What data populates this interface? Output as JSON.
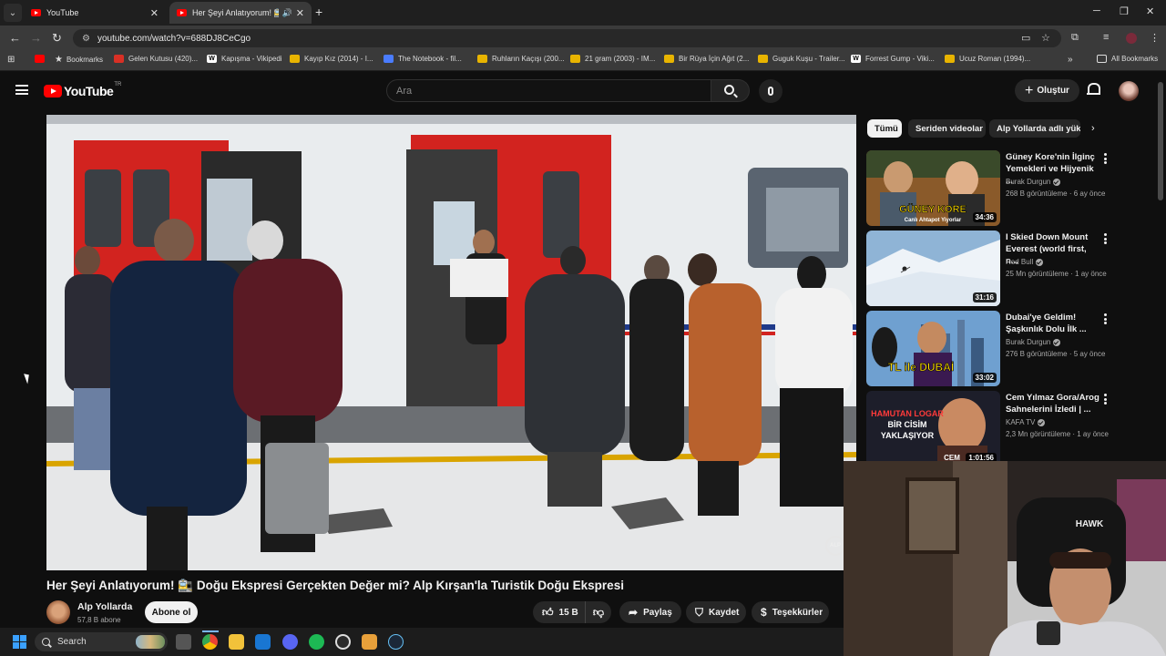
{
  "browser": {
    "tabs": [
      {
        "title": "YouTube",
        "active": false
      },
      {
        "title": "Her Şeyi Anlatıyorum! 🚉 D",
        "active": true
      }
    ],
    "url": "youtube.com/watch?v=688DJ8CeCgo",
    "bookmarks": [
      {
        "label": "Bookmarks",
        "icon": "star-icon"
      },
      {
        "label": "Gelen Kutusu (420)...",
        "icon": "gmail-icon"
      },
      {
        "label": "Kapışma - Vikipedi",
        "icon": "wikipedia-icon"
      },
      {
        "label": "Kayıp Kız (2014) - I...",
        "icon": "imdb-icon"
      },
      {
        "label": "The Notebook - fil...",
        "icon": "site-icon"
      },
      {
        "label": "Ruhların Kaçışı (200...",
        "icon": "imdb-icon"
      },
      {
        "label": "21 gram (2003) - IM...",
        "icon": "imdb-icon"
      },
      {
        "label": "Bir Rüya İçin Ağıt (2...",
        "icon": "imdb-icon"
      },
      {
        "label": "Guguk Kuşu - Trailer...",
        "icon": "imdb-icon"
      },
      {
        "label": "Forrest Gump - Viki...",
        "icon": "wikipedia-icon"
      },
      {
        "label": "Ucuz Roman (1994)...",
        "icon": "imdb-icon"
      }
    ],
    "all_bookmarks": "All Bookmarks"
  },
  "header": {
    "logo_text": "YouTube",
    "logo_region": "TR",
    "search_placeholder": "Ara",
    "create_label": "Oluştur"
  },
  "video": {
    "title": "Her Şeyi Anlatıyorum! 🚉 Doğu Ekspresi Gerçekten Değer mi? Alp Kırşan'la Turistik Doğu Ekspresi",
    "channel_name": "Alp Yollarda",
    "subscribers": "57,8 B abone",
    "subscribe_label": "Abone ol",
    "likes": "15 B",
    "share_label": "Paylaş",
    "save_label": "Kaydet",
    "thanks_label": "Teşekkürler",
    "watermark": "ALP"
  },
  "sidebar": {
    "chips": [
      "Tümü",
      "Seriden videolar",
      "Alp Yollarda adlı yükle"
    ],
    "recommendations": [
      {
        "title": "Güney Kore'nin İlginç Yemekleri ve Hijyenik ...",
        "channel": "Burak Durgun",
        "verified": true,
        "meta": "268 B görüntüleme · 6 ay önce",
        "duration": "34:36",
        "thumb_text": "GÜNEY KORE",
        "thumb_sub": "Canlı Ahtapot Yiyorlar"
      },
      {
        "title": "I Skied Down Mount Everest (world first, n...",
        "channel": "Red Bull",
        "verified": true,
        "meta": "25 Mn görüntüleme · 1 ay önce",
        "duration": "31:16",
        "thumb_text": "",
        "thumb_sub": ""
      },
      {
        "title": "Dubai'ye Geldim! Şaşkınlık Dolu İlk ...",
        "channel": "Burak Durgun",
        "verified": true,
        "meta": "276 B görüntüleme · 5 ay önce",
        "duration": "33:02",
        "thumb_text": "TL ile DUBAİ",
        "thumb_sub": ""
      },
      {
        "title": "Cem Yılmaz Gora/Arog Sahnelerini İzledi | ...",
        "channel": "KAFA TV",
        "verified": true,
        "meta": "2,3 Mn görüntüleme · 1 ay önce",
        "duration": "1:01:56",
        "thumb_text": "HAMUTAN LOGAR BİR CİSİM YAKLAŞIYOR",
        "thumb_sub": "CEM"
      }
    ]
  },
  "webcam": {
    "chair_brand": "HAWK"
  },
  "taskbar": {
    "search_label": "Search",
    "apps": [
      "task-view-icon",
      "chrome-icon",
      "file-explorer-icon",
      "outlook-icon",
      "discord-icon",
      "spotify-icon",
      "recorder-icon",
      "app-icon",
      "steam-icon"
    ]
  }
}
